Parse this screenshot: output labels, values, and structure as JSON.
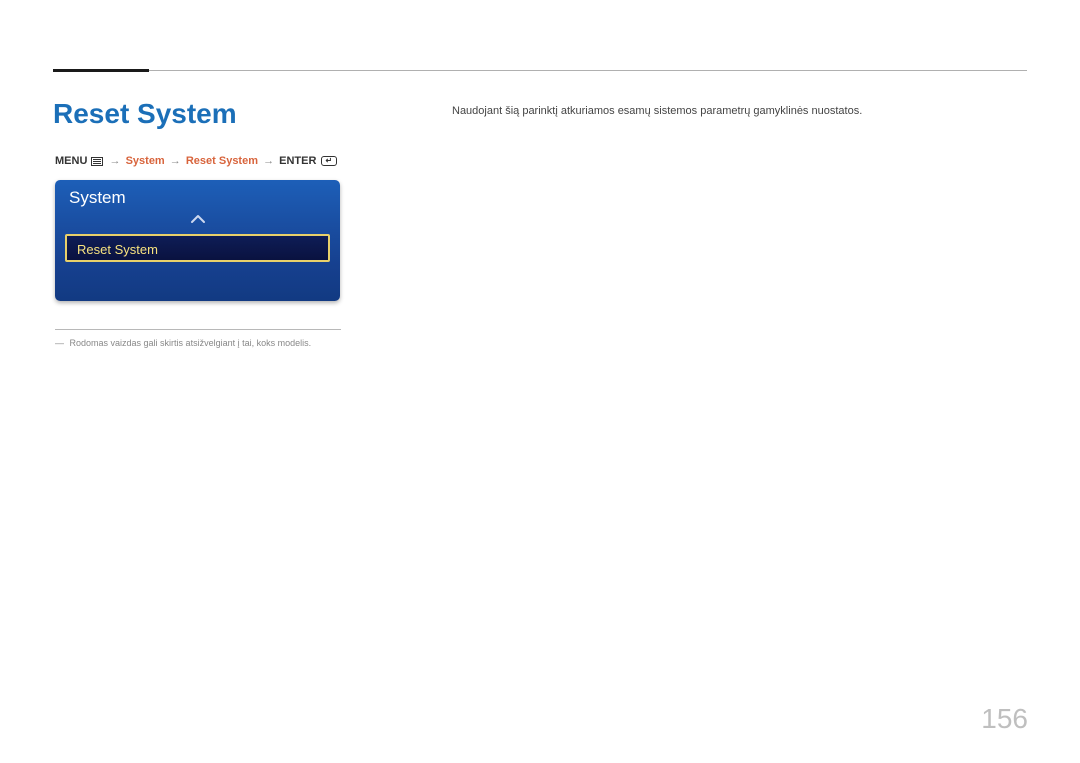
{
  "page": {
    "title": "Reset System",
    "number": "156",
    "description": "Naudojant šią parinktį atkuriamos esamų sistemos parametrų gamyklinės nuostatos."
  },
  "breadcrumb": {
    "menu_label": "MENU",
    "path1": "System",
    "path2": "Reset System",
    "enter_label": "ENTER",
    "arrow": "→"
  },
  "osd": {
    "panel_title": "System",
    "selected_item": "Reset System"
  },
  "footnote": {
    "dash": "―",
    "text": "Rodomas vaizdas gali skirtis atsižvelgiant į tai, koks modelis."
  }
}
